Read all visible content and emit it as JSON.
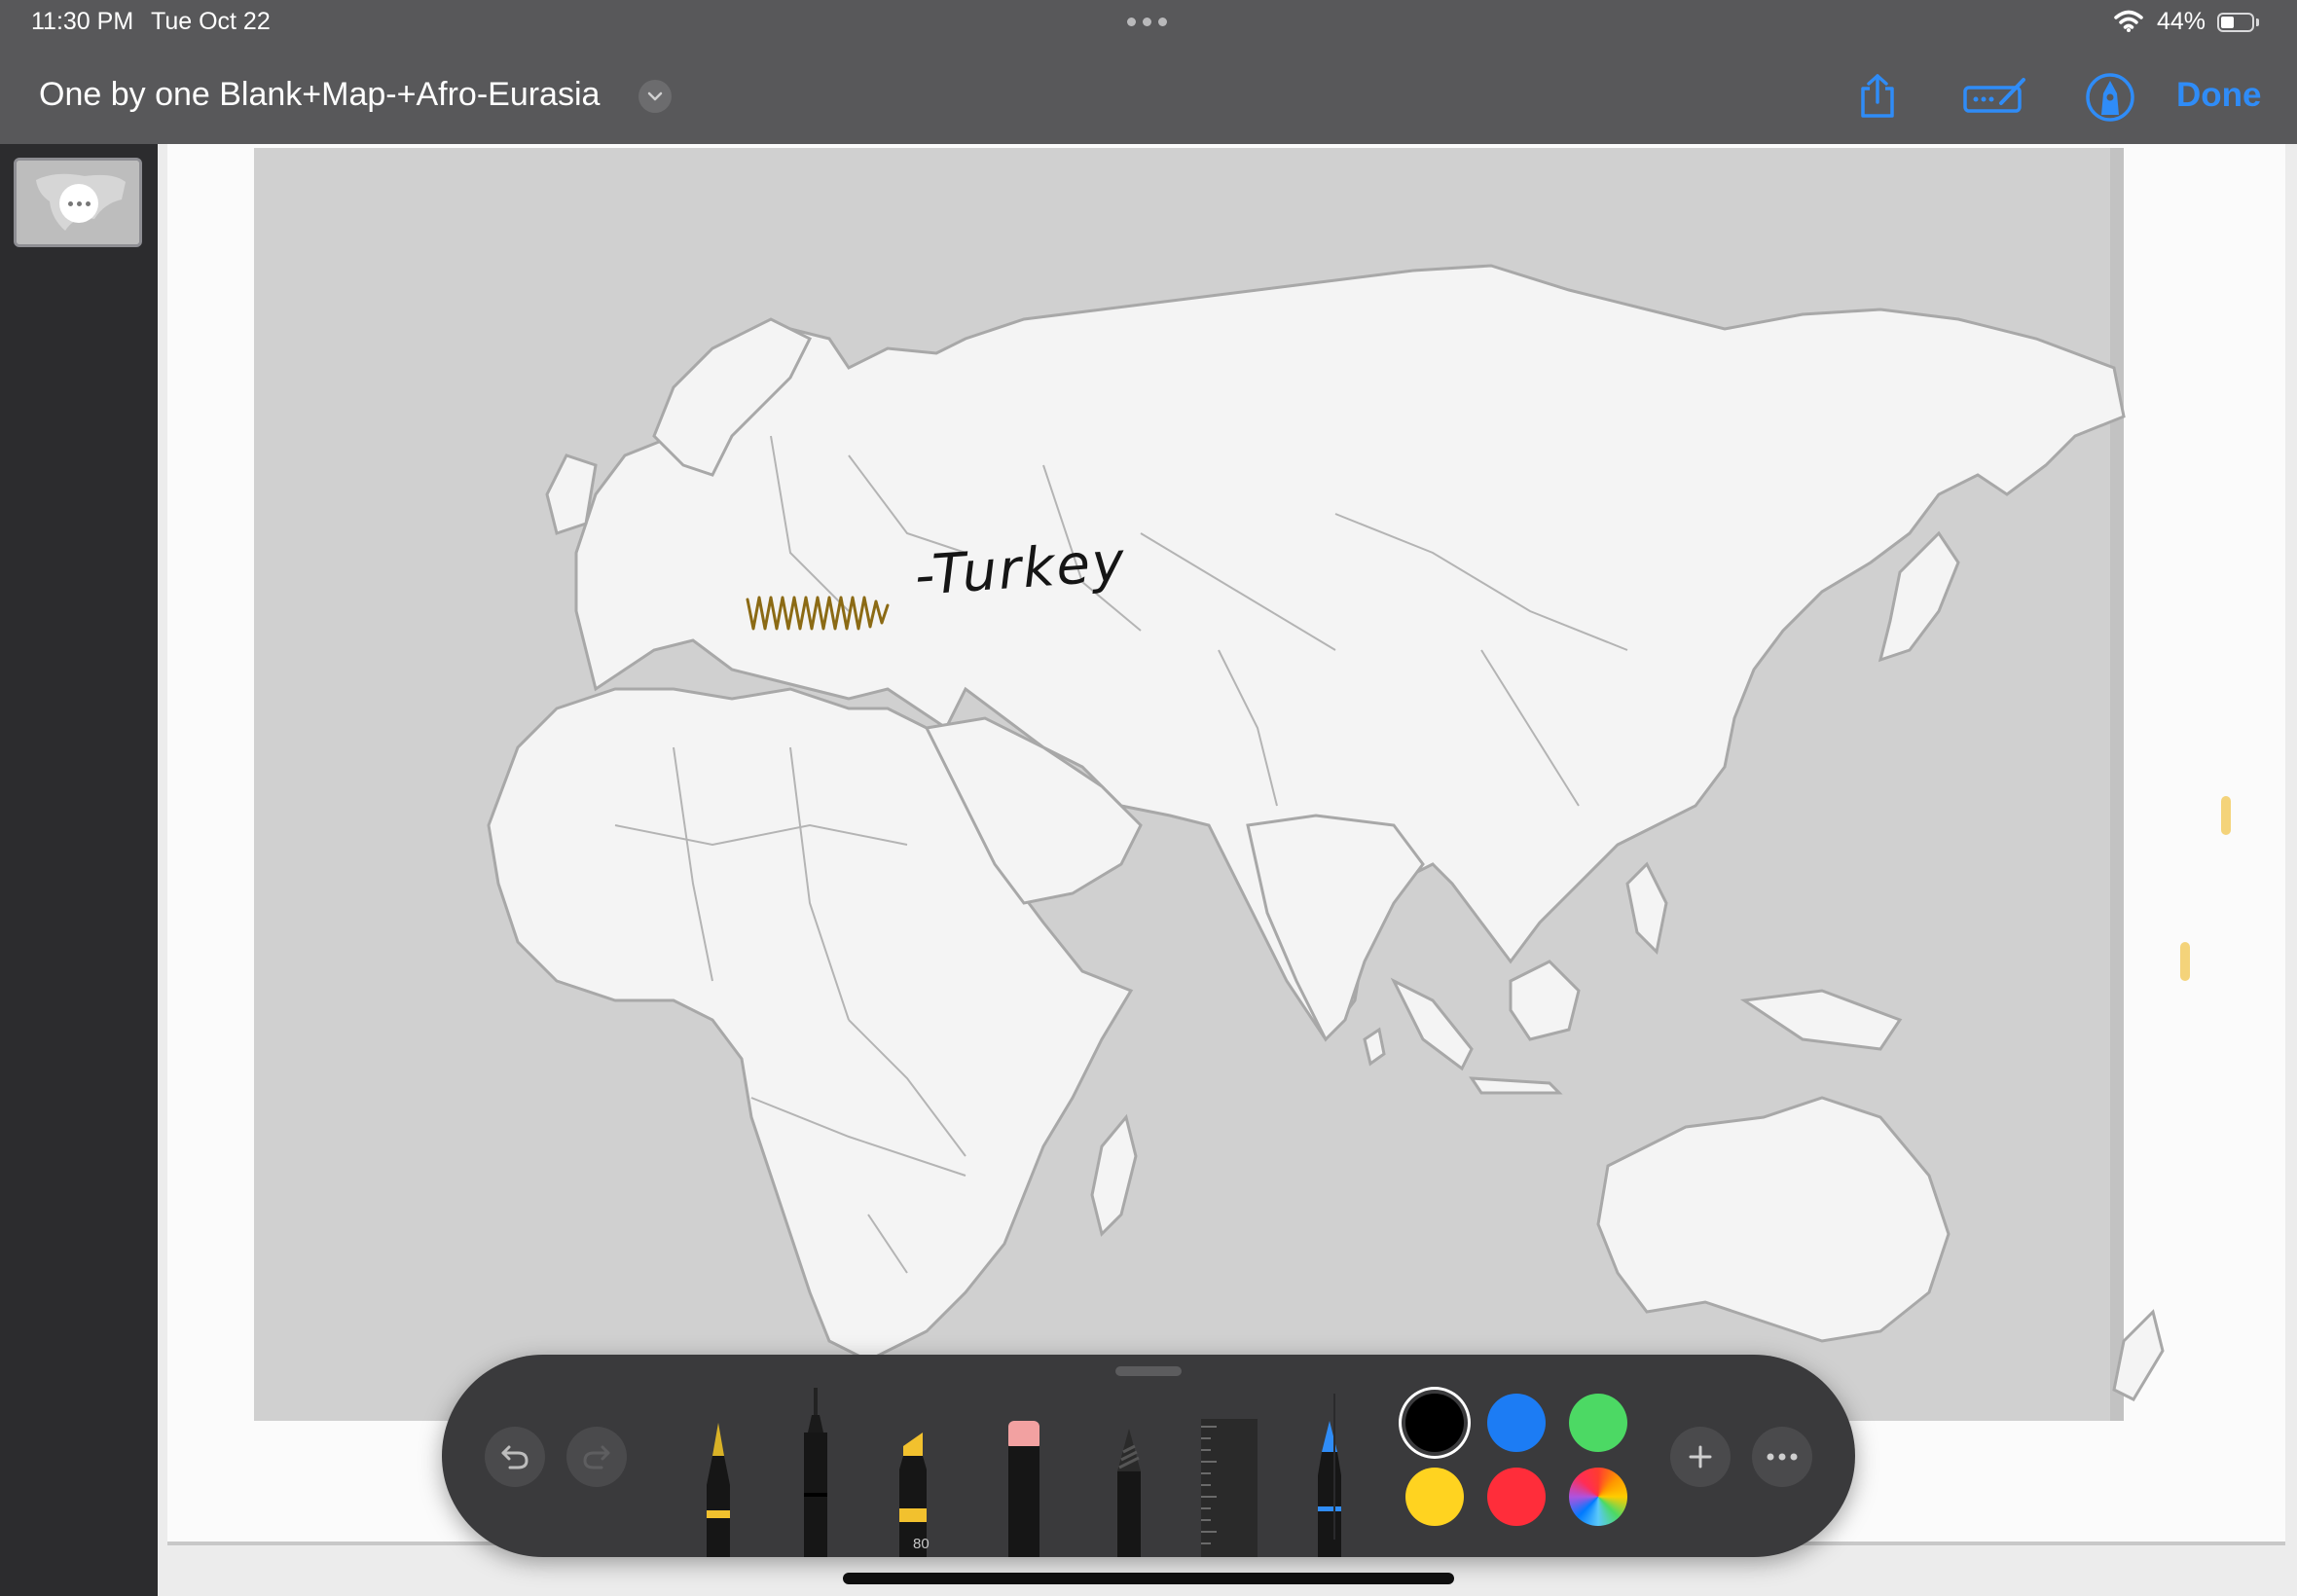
{
  "status_bar": {
    "time": "11:30 PM",
    "date": "Tue Oct 22",
    "battery_percent": "44%",
    "battery_level": 0.44,
    "wifi_icon": "wifi-icon"
  },
  "nav": {
    "document_title": "One by one Blank+Map-+Afro-Eurasia",
    "title_menu_icon": "chevron-down-icon",
    "share_icon": "share-icon",
    "markup_icon": "markup-pen-icon",
    "pencil_circle_icon": "pencil-tip-circle-icon",
    "done_label": "Done",
    "accent_color": "#2f8cf7"
  },
  "sidebar": {
    "page_thumbnail_more_icon": "ellipsis-icon"
  },
  "document": {
    "content": "blank outline map of Afro-Eurasia",
    "annotation": {
      "text": "-Turkey",
      "scribble_color": "#8b6a14"
    }
  },
  "tool_palette": {
    "undo_icon": "undo-icon",
    "redo_icon": "redo-icon",
    "tools": [
      {
        "name": "pen",
        "band_color": "#f2c12e"
      },
      {
        "name": "fineliner",
        "band_color": "#111111"
      },
      {
        "name": "highlighter",
        "band_color": "#f2c12e",
        "label": "80"
      },
      {
        "name": "eraser",
        "band_color": "#f2a1a1"
      },
      {
        "name": "pencil",
        "band_color": "#666666"
      },
      {
        "name": "ruler",
        "band_color": "#444444"
      },
      {
        "name": "fountain-pen",
        "band_color": "#2f8cf7"
      }
    ],
    "colors": [
      {
        "name": "black",
        "hex": "#000000",
        "selected": true
      },
      {
        "name": "blue",
        "hex": "#1c7cf4"
      },
      {
        "name": "green",
        "hex": "#4cd964"
      },
      {
        "name": "yellow",
        "hex": "#ffd320"
      },
      {
        "name": "red",
        "hex": "#ff2d3a"
      },
      {
        "name": "multicolor",
        "hex": "#ff9500"
      }
    ],
    "add_icon": "plus-icon",
    "more_icon": "ellipsis-icon"
  }
}
